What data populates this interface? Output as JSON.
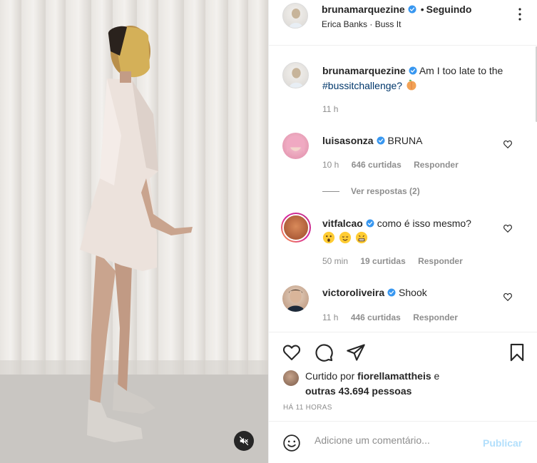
{
  "colors": {
    "accent": "#0095f6",
    "accent_disabled": "#b2dffc",
    "text": "#262626",
    "muted": "#8e8e8e",
    "verified": "#3897f0"
  },
  "header": {
    "username": "brunamarquezine",
    "separator": "•",
    "follow_status": "Seguindo",
    "audio_artist": "Erica Banks",
    "audio_dot": "·",
    "audio_title": "Buss It"
  },
  "caption": {
    "username": "brunamarquezine",
    "text_before": "Am I too late to the",
    "hashtag": "#bussitchallenge?",
    "emoji": "peach-emoji",
    "time": "11 h"
  },
  "comments": [
    {
      "username": "luisasonza",
      "text": "BRUNA",
      "time": "10 h",
      "likes": "646 curtidas",
      "reply": "Responder",
      "view_replies": "Ver respostas (2)"
    },
    {
      "username": "vitfalcao",
      "text": "como é isso mesmo?",
      "emojis": [
        "astonished-face-emoji",
        "relieved-face-emoji",
        "grimacing-face-emoji"
      ],
      "time": "50 min",
      "likes": "19 curtidas",
      "reply": "Responder"
    },
    {
      "username": "victoroliveira",
      "text": "Shook",
      "time": "11 h",
      "likes": "446 curtidas",
      "reply": "Responder"
    }
  ],
  "likes": {
    "prefix": "Curtido por",
    "user": "fiorellamattheis",
    "connector": "e",
    "others": "outras 43.694 pessoas"
  },
  "posted": "HÁ 11 HORAS",
  "composer": {
    "placeholder": "Adicione um comentário...",
    "post_label": "Publicar"
  },
  "icons": {
    "more": "more-options-icon",
    "like": "heart-icon",
    "comment": "comment-icon",
    "share": "paper-plane-icon",
    "save": "bookmark-icon",
    "mute": "speaker-muted-icon",
    "emoji": "smiley-icon"
  }
}
